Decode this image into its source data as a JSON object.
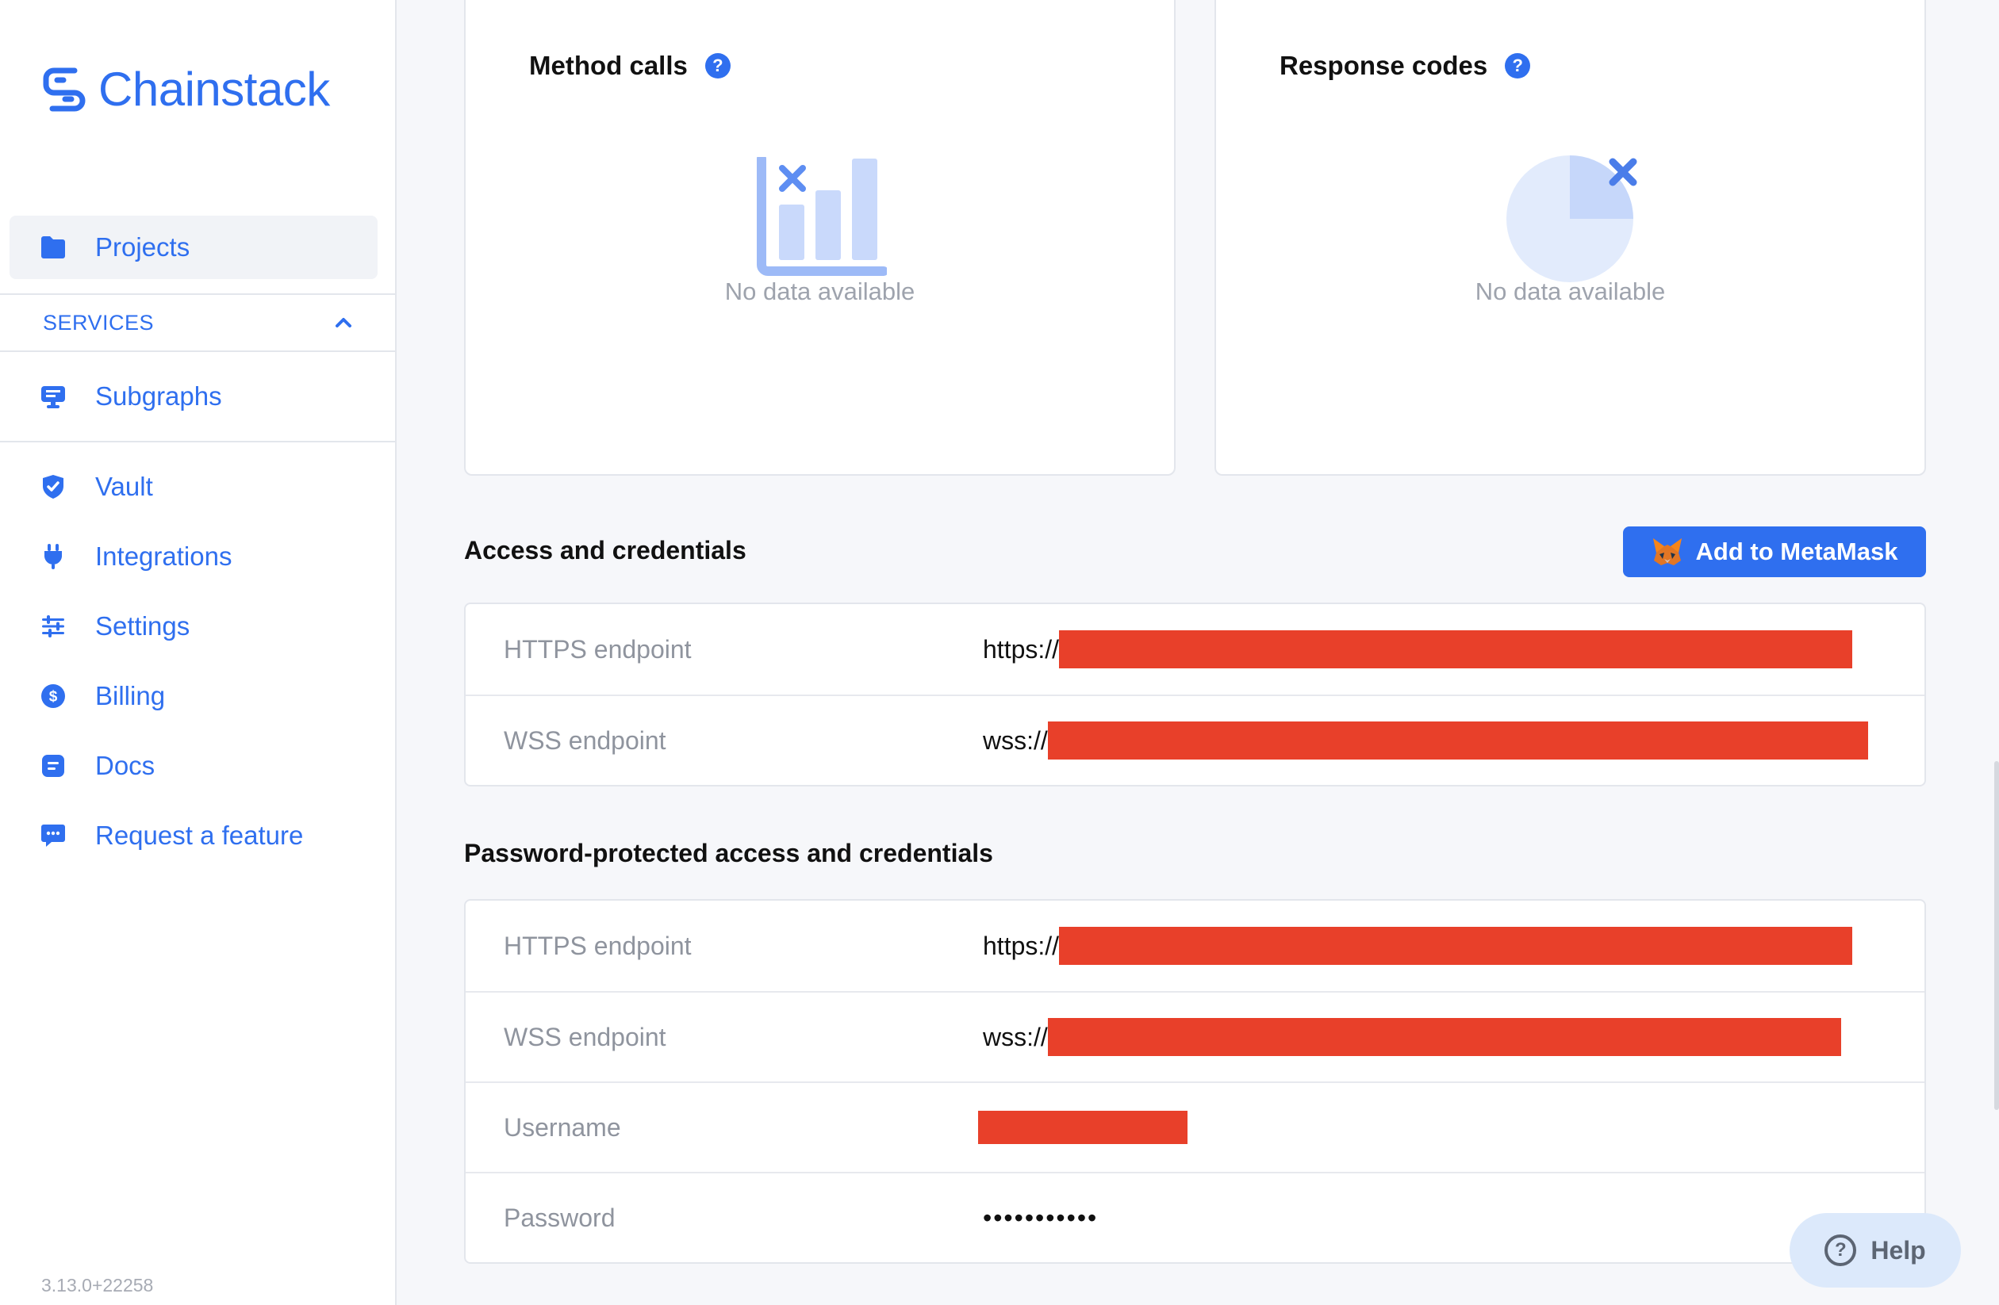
{
  "brand": {
    "name": "Chainstack",
    "color": "#2f6fef"
  },
  "sidebar": {
    "projects_label": "Projects",
    "services_label": "SERVICES",
    "subgraphs_label": "Subgraphs",
    "items": [
      {
        "label": "Vault",
        "icon": "shield-check-icon"
      },
      {
        "label": "Integrations",
        "icon": "plug-icon"
      },
      {
        "label": "Settings",
        "icon": "sliders-icon"
      },
      {
        "label": "Billing",
        "icon": "dollar-circle-icon"
      },
      {
        "label": "Docs",
        "icon": "document-icon"
      },
      {
        "label": "Request a feature",
        "icon": "chat-bubble-icon"
      }
    ],
    "version": "3.13.0+22258"
  },
  "cards": {
    "method_calls": {
      "title": "Method calls",
      "help": "?",
      "empty": "No data available"
    },
    "response_codes": {
      "title": "Response codes",
      "help": "?",
      "empty": "No data available"
    }
  },
  "access": {
    "title": "Access and credentials",
    "metamask_label": "Add to MetaMask",
    "rows": [
      {
        "label": "HTTPS endpoint",
        "prefix": "https://"
      },
      {
        "label": "WSS endpoint",
        "prefix": "wss://"
      }
    ]
  },
  "protected": {
    "title": "Password-protected access and credentials",
    "rows": [
      {
        "label": "HTTPS endpoint",
        "prefix": "https://"
      },
      {
        "label": "WSS endpoint",
        "prefix": "wss://"
      },
      {
        "label": "Username",
        "prefix": ""
      },
      {
        "label": "Password",
        "value": "•••••••••••"
      }
    ]
  },
  "help_button": {
    "label": "Help",
    "glyph": "?"
  },
  "colors": {
    "redaction": "#e8402a",
    "accent": "#2f6fef",
    "muted": "#9ea3ad"
  }
}
